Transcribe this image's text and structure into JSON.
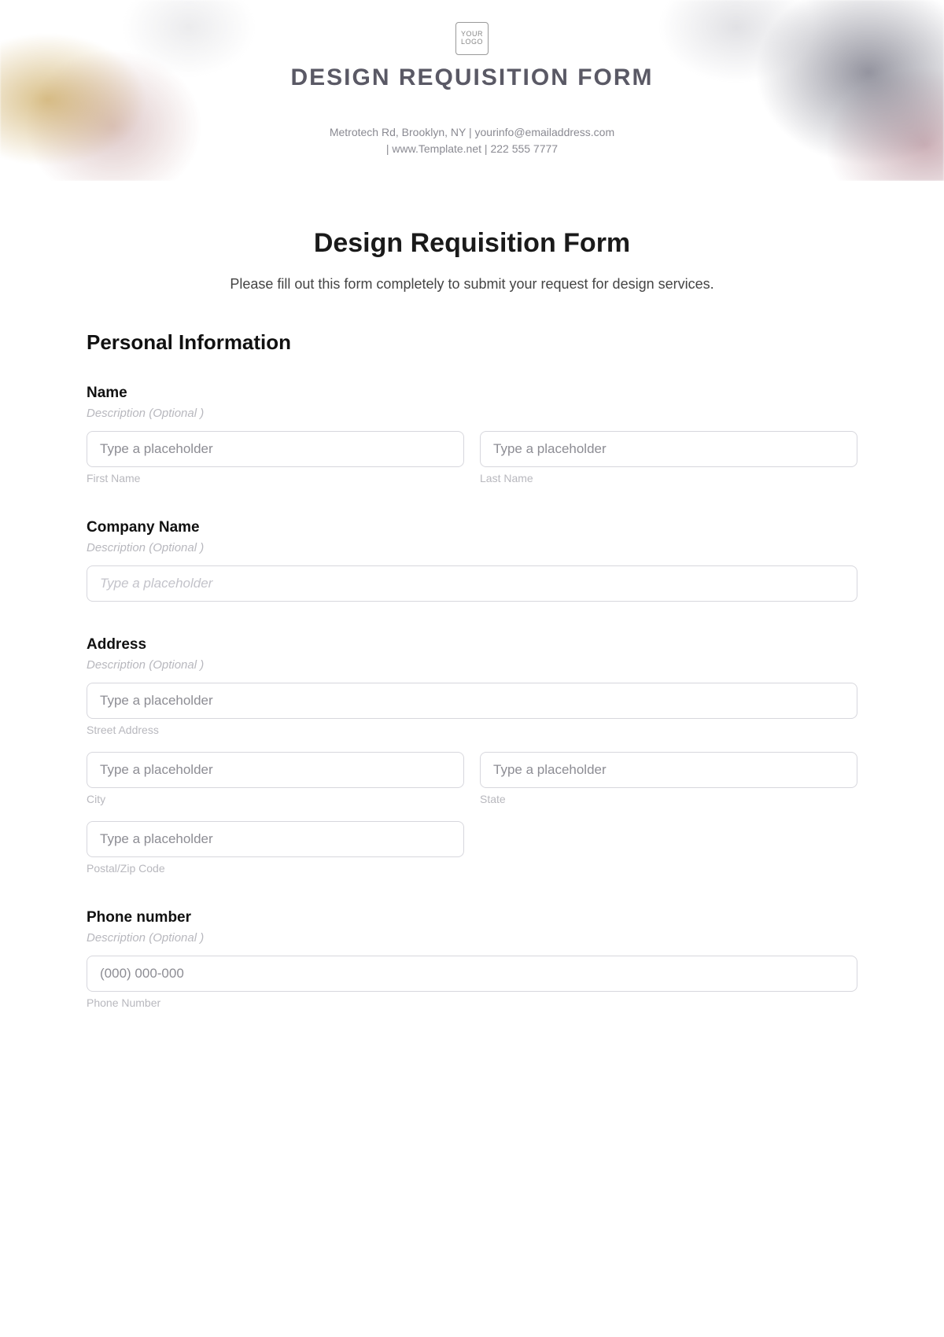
{
  "hero": {
    "logo_text": "YOUR LOGO",
    "title": "DESIGN REQUISITION FORM",
    "meta_line1": "Metrotech Rd, Brooklyn, NY  |  yourinfo@emailaddress.com",
    "meta_line2": "|  www.Template.net  |  222 555 7777"
  },
  "page": {
    "title": "Design Requisition Form",
    "intro": "Please fill out this form completely to submit your request for design services."
  },
  "section": {
    "personal_info": "Personal Information"
  },
  "fields": {
    "name": {
      "label": "Name",
      "desc": "Description (Optional )",
      "first_placeholder": "Type a placeholder",
      "first_sub": "First Name",
      "last_placeholder": "Type a placeholder",
      "last_sub": "Last Name"
    },
    "company": {
      "label": "Company Name",
      "desc": "Description (Optional )",
      "placeholder": "Type a placeholder"
    },
    "address": {
      "label": "Address",
      "desc": "Description (Optional )",
      "street_placeholder": "Type a placeholder",
      "street_sub": "Street Address",
      "city_placeholder": "Type a placeholder",
      "city_sub": "City",
      "state_placeholder": "Type a placeholder",
      "state_sub": "State",
      "postal_placeholder": "Type a placeholder",
      "postal_sub": "Postal/Zip Code"
    },
    "phone": {
      "label": "Phone number",
      "desc": "Description (Optional )",
      "placeholder": "(000) 000-000",
      "sub": "Phone Number"
    }
  }
}
